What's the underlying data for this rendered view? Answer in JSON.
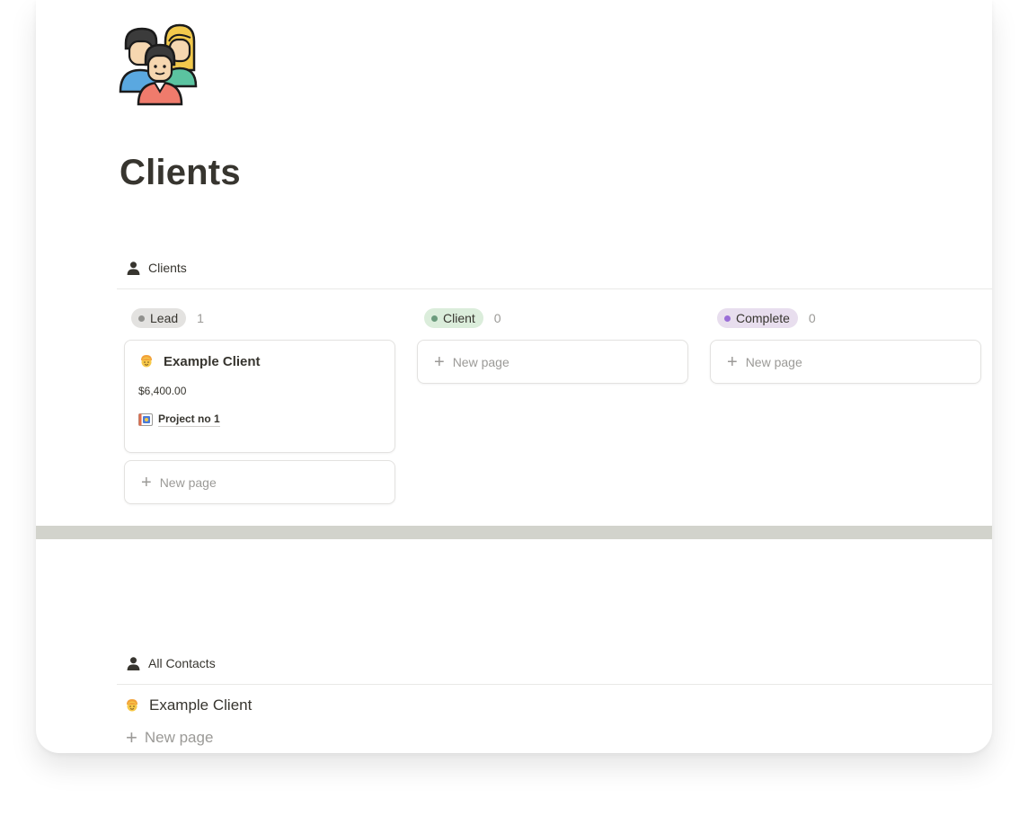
{
  "page": {
    "title": "Clients",
    "icon": "people-group-icon"
  },
  "board": {
    "view_label": "Clients",
    "view_icon": "person-icon",
    "columns": [
      {
        "label": "Lead",
        "count": "1",
        "pill_bg": "#e3e2e0",
        "dot_color": "#91918e",
        "cards": [
          {
            "title": "Example Client",
            "icon": "client-face-icon",
            "amount": "$6,400.00",
            "relation": "Project no 1",
            "relation_icon": "project-page-icon"
          }
        ],
        "new_label": "New page"
      },
      {
        "label": "Client",
        "count": "0",
        "pill_bg": "#dbeddb",
        "dot_color": "#6c9b7d",
        "cards": [],
        "new_label": "New page"
      },
      {
        "label": "Complete",
        "count": "0",
        "pill_bg": "#e8deee",
        "dot_color": "#9a6dd7",
        "cards": [],
        "new_label": "New page"
      }
    ]
  },
  "contacts": {
    "view_label": "All Contacts",
    "view_icon": "person-icon",
    "rows": [
      {
        "title": "Example Client",
        "icon": "client-face-icon"
      }
    ],
    "new_label": "New page"
  }
}
